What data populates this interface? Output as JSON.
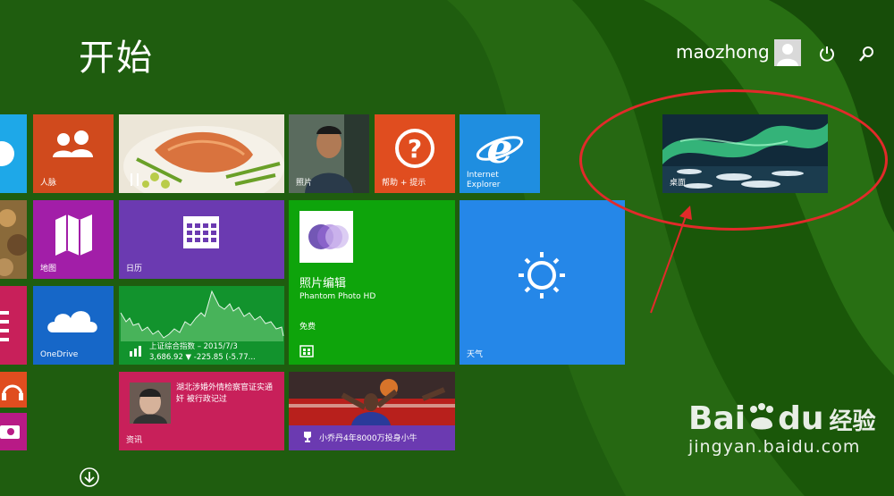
{
  "start": {
    "title": "开始"
  },
  "user": {
    "name": "maozhong"
  },
  "icons": {
    "power": "power-icon",
    "search": "search-icon",
    "download": "arrow-down-circle-icon"
  },
  "tiles": {
    "people": {
      "label": "人脉",
      "color": "#d04a1d"
    },
    "food": {
      "label": "",
      "color": "#e9e2d2"
    },
    "photos": {
      "label": "照片",
      "color": "#4a4a4a"
    },
    "help": {
      "label": "帮助 + 提示",
      "color": "#e04d1f"
    },
    "ie": {
      "label": "Internet\nExplorer",
      "label1": "Internet",
      "label2": "Explorer",
      "color": "#1f8ee0"
    },
    "maps": {
      "label": "地图",
      "color": "#a21ea8"
    },
    "calendar": {
      "label": "日历",
      "color": "#6b3ab1"
    },
    "photoeditor": {
      "title": "照片编辑",
      "subtitle": "Phantom Photo HD",
      "price": "免费",
      "color": "#0ea40b"
    },
    "weather": {
      "label": "天气",
      "color": "#2587e8"
    },
    "onedrive": {
      "label": "OneDrive",
      "color": "#1667c8"
    },
    "finance": {
      "line1": "上证综合指数 – 2015/7/3",
      "line2": "3,686.92  ▼ -225.85 (-5.77...",
      "color": "#12932d"
    },
    "news": {
      "headline": "湖北涉婚外情检察官证实通奸 被行政记过",
      "label": "资讯",
      "color": "#c8205a"
    },
    "sports": {
      "headline": "小乔丹4年8000万投身小牛",
      "color": "#6b3ab1"
    },
    "desktop": {
      "label": "桌面"
    }
  },
  "watermark": {
    "brand": "Bai",
    "brand2": "du",
    "brand_cn": "经验",
    "url": "jingyan.baidu.com"
  }
}
